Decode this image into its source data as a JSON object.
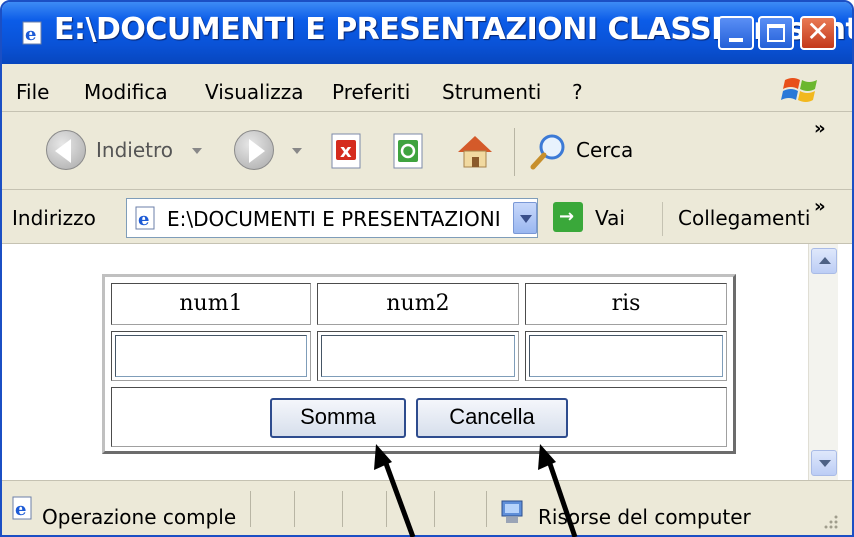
{
  "window": {
    "title": "E:\\DOCUMENTI E PRESENTAZIONI CLASSI\\present...",
    "minimize_label": "",
    "maximize_label": "",
    "close_glyph": "✕"
  },
  "menu": {
    "items": [
      {
        "label": "File"
      },
      {
        "label": "Modifica"
      },
      {
        "label": "Visualizza"
      },
      {
        "label": "Preferiti"
      },
      {
        "label": "Strumenti"
      },
      {
        "label": "?"
      }
    ]
  },
  "toolbar": {
    "back_label": "Indietro",
    "search_label": "Cerca",
    "chevron": "»"
  },
  "address": {
    "label": "Indirizzo",
    "value": "E:\\DOCUMENTI E PRESENTAZIONI",
    "go_label": "Vai",
    "go_arrow": "→",
    "links_label": "Collegamenti",
    "chevron": "»"
  },
  "form": {
    "headers": [
      "num1",
      "num2",
      "ris"
    ],
    "inputs": [
      "",
      "",
      ""
    ],
    "sum_button": "Somma",
    "clear_button": "Cancella"
  },
  "status": {
    "text": "Operazione comple",
    "zone": "Risorse del computer"
  },
  "colors": {
    "titlebar": "#0a52d6",
    "chrome": "#ece9d8",
    "button_border": "#2e4c8e",
    "annotation_arrow": "#000000"
  },
  "icons": {
    "title": "ie-page-icon",
    "back": "back-arrow-icon",
    "forward": "forward-arrow-icon",
    "stop": "stop-icon",
    "refresh": "refresh-icon",
    "home": "home-icon",
    "search": "search-magnifier-icon",
    "go": "go-arrow-icon",
    "status": "ie-page-icon",
    "zone": "my-computer-icon"
  }
}
